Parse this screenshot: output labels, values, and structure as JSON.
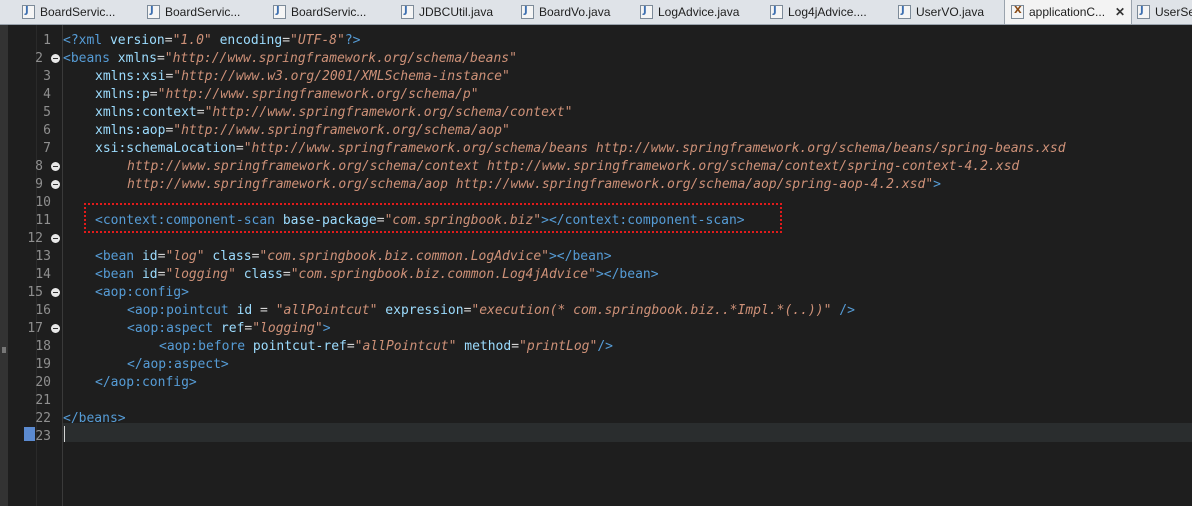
{
  "tabs": [
    {
      "label": "BoardServic...",
      "icon": "java-file-icon",
      "type": "java"
    },
    {
      "label": "BoardServic...",
      "icon": "java-file-icon",
      "type": "java"
    },
    {
      "label": "BoardServic...",
      "icon": "java-file-icon",
      "type": "java"
    },
    {
      "label": "JDBCUtil.java",
      "icon": "java-file-icon",
      "type": "java"
    },
    {
      "label": "BoardVo.java",
      "icon": "java-file-icon",
      "type": "java"
    },
    {
      "label": "LogAdvice.java",
      "icon": "java-file-icon",
      "type": "java"
    },
    {
      "label": "Log4jAdvice....",
      "icon": "java-file-icon",
      "type": "java"
    },
    {
      "label": "UserVO.java",
      "icon": "java-file-icon",
      "type": "java"
    },
    {
      "label": "applicationC...",
      "icon": "xml-file-icon",
      "type": "xml",
      "active": true,
      "close": "✕"
    },
    {
      "label": "UserSe",
      "icon": "java-file-icon",
      "type": "java"
    }
  ],
  "lines": [
    {
      "n": "1",
      "fold": false,
      "indent": 0,
      "tokens": [
        [
          "tag",
          "<?xml "
        ],
        [
          "attr",
          "version"
        ],
        [
          "plain",
          "="
        ],
        [
          "val",
          "\"1.0\""
        ],
        [
          "plain",
          " "
        ],
        [
          "attr",
          "encoding"
        ],
        [
          "plain",
          "="
        ],
        [
          "val",
          "\"UTF-8\""
        ],
        [
          "tag",
          "?>"
        ]
      ]
    },
    {
      "n": "2",
      "fold": true,
      "indent": 0,
      "tokens": [
        [
          "tag",
          "<beans "
        ],
        [
          "attr",
          "xmlns"
        ],
        [
          "plain",
          "="
        ],
        [
          "val",
          "\"http://www.springframework.org/schema/beans\""
        ]
      ]
    },
    {
      "n": "3",
      "fold": false,
      "indent": 4,
      "tokens": [
        [
          "attr",
          "xmlns:xsi"
        ],
        [
          "plain",
          "="
        ],
        [
          "val",
          "\"http://www.w3.org/2001/XMLSchema-instance\""
        ]
      ]
    },
    {
      "n": "4",
      "fold": false,
      "indent": 4,
      "tokens": [
        [
          "attr",
          "xmlns:p"
        ],
        [
          "plain",
          "="
        ],
        [
          "val",
          "\"http://www.springframework.org/schema/p\""
        ]
      ]
    },
    {
      "n": "5",
      "fold": false,
      "indent": 4,
      "tokens": [
        [
          "attr",
          "xmlns:context"
        ],
        [
          "plain",
          "="
        ],
        [
          "val",
          "\"http://www.springframework.org/schema/context\""
        ]
      ]
    },
    {
      "n": "6",
      "fold": false,
      "indent": 4,
      "tokens": [
        [
          "attr",
          "xmlns:aop"
        ],
        [
          "plain",
          "="
        ],
        [
          "val",
          "\"http://www.springframework.org/schema/aop\""
        ]
      ]
    },
    {
      "n": "7",
      "fold": false,
      "indent": 4,
      "tokens": [
        [
          "attr",
          "xsi:schemaLocation"
        ],
        [
          "plain",
          "="
        ],
        [
          "val",
          "\"http://www.springframework.org/schema/beans http://www.springframework.org/schema/beans/spring-beans.xsd"
        ]
      ]
    },
    {
      "n": "8",
      "fold": true,
      "indent": 8,
      "tokens": [
        [
          "val",
          "http://www.springframework.org/schema/context http://www.springframework.org/schema/context/spring-context-4.2.xsd"
        ]
      ]
    },
    {
      "n": "9",
      "fold": true,
      "indent": 8,
      "tokens": [
        [
          "val",
          "http://www.springframework.org/schema/aop http://www.springframework.org/schema/aop/spring-aop-4.2.xsd\""
        ],
        [
          "tag",
          ">"
        ]
      ]
    },
    {
      "n": "10",
      "fold": false,
      "indent": 0,
      "tokens": []
    },
    {
      "n": "11",
      "fold": false,
      "indent": 4,
      "tokens": [
        [
          "tag",
          "<context:component-scan "
        ],
        [
          "attr",
          "base-package"
        ],
        [
          "plain",
          "="
        ],
        [
          "val",
          "\"com.springbook.biz\""
        ],
        [
          "tag",
          "></context:component-scan>"
        ]
      ]
    },
    {
      "n": "12",
      "fold": true,
      "indent": 0,
      "tokens": []
    },
    {
      "n": "13",
      "fold": false,
      "indent": 4,
      "tokens": [
        [
          "tag",
          "<bean "
        ],
        [
          "attr",
          "id"
        ],
        [
          "plain",
          "="
        ],
        [
          "val",
          "\"log\""
        ],
        [
          "plain",
          " "
        ],
        [
          "attr",
          "class"
        ],
        [
          "plain",
          "="
        ],
        [
          "val",
          "\"com.springbook.biz.common.LogAdvice\""
        ],
        [
          "tag",
          "></bean>"
        ]
      ]
    },
    {
      "n": "14",
      "fold": false,
      "indent": 4,
      "tokens": [
        [
          "tag",
          "<bean "
        ],
        [
          "attr",
          "id"
        ],
        [
          "plain",
          "="
        ],
        [
          "val",
          "\"logging\""
        ],
        [
          "plain",
          " "
        ],
        [
          "attr",
          "class"
        ],
        [
          "plain",
          "="
        ],
        [
          "val",
          "\"com.springbook.biz.common.Log4jAdvice\""
        ],
        [
          "tag",
          "></bean>"
        ]
      ]
    },
    {
      "n": "15",
      "fold": true,
      "indent": 4,
      "tokens": [
        [
          "tag",
          "<aop:config>"
        ]
      ]
    },
    {
      "n": "16",
      "fold": false,
      "indent": 8,
      "tokens": [
        [
          "tag",
          "<aop:pointcut "
        ],
        [
          "attr",
          "id"
        ],
        [
          "plain",
          " = "
        ],
        [
          "val",
          "\"allPointcut\""
        ],
        [
          "plain",
          " "
        ],
        [
          "attr",
          "expression"
        ],
        [
          "plain",
          "="
        ],
        [
          "val",
          "\"execution(* com.springbook.biz..*Impl.*(..))\""
        ],
        [
          "plain",
          " "
        ],
        [
          "tag",
          "/>"
        ]
      ]
    },
    {
      "n": "17",
      "fold": true,
      "indent": 8,
      "tokens": [
        [
          "tag",
          "<aop:aspect "
        ],
        [
          "attr",
          "ref"
        ],
        [
          "plain",
          "="
        ],
        [
          "val",
          "\"logging\""
        ],
        [
          "tag",
          ">"
        ]
      ]
    },
    {
      "n": "18",
      "fold": false,
      "indent": 12,
      "tokens": [
        [
          "tag",
          "<aop:before "
        ],
        [
          "attr",
          "pointcut-ref"
        ],
        [
          "plain",
          "="
        ],
        [
          "val",
          "\"allPointcut\""
        ],
        [
          "plain",
          " "
        ],
        [
          "attr",
          "method"
        ],
        [
          "plain",
          "="
        ],
        [
          "val",
          "\"printLog\""
        ],
        [
          "tag",
          "/>"
        ]
      ]
    },
    {
      "n": "19",
      "fold": false,
      "indent": 8,
      "tokens": [
        [
          "tag",
          "</aop:aspect>"
        ]
      ]
    },
    {
      "n": "20",
      "fold": false,
      "indent": 4,
      "tokens": [
        [
          "tag",
          "</aop:config>"
        ]
      ]
    },
    {
      "n": "21",
      "fold": false,
      "indent": 0,
      "tokens": []
    },
    {
      "n": "22",
      "fold": false,
      "indent": 0,
      "tokens": [
        [
          "tag",
          "</beans>"
        ]
      ]
    },
    {
      "n": "23",
      "fold": false,
      "indent": 0,
      "tokens": [],
      "current": true
    }
  ],
  "colors": {
    "background": "#1e1e1e",
    "tag": "#569cd6",
    "attribute": "#9cdcfe",
    "value": "#ce9178",
    "highlight_box": "#e21b1b"
  }
}
